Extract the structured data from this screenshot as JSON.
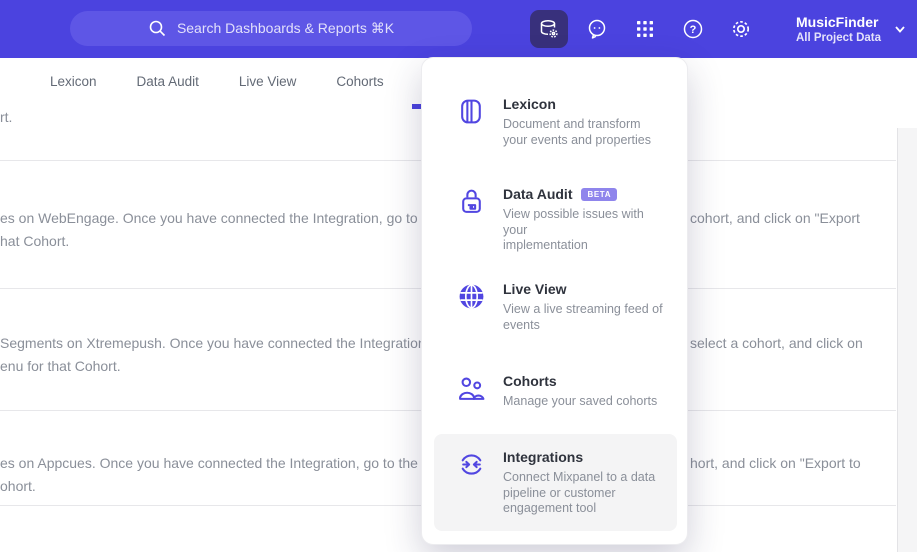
{
  "header": {
    "search": {
      "placeholder": "Search Dashboards & Reports ⌘K",
      "icon": "search-icon"
    },
    "nav_icons": [
      {
        "name": "data-management-icon",
        "active": true
      },
      {
        "name": "feedback-icon",
        "active": false
      },
      {
        "name": "apps-grid-icon",
        "active": false
      },
      {
        "name": "help-icon",
        "active": false
      },
      {
        "name": "settings-gear-icon",
        "active": false
      }
    ],
    "project": {
      "name": "MusicFinder",
      "subtitle": "All Project Data",
      "chevron": "chevron-down-icon"
    }
  },
  "tabs": {
    "items": [
      "Lexicon",
      "Data Audit",
      "Live View",
      "Cohorts"
    ],
    "accent_color": "#4b43df"
  },
  "menu": {
    "items": [
      {
        "title": "Lexicon",
        "icon": "book-icon",
        "desc_lines": [
          "Document and transform",
          "your events and properties"
        ]
      },
      {
        "title": "Data Audit",
        "badge": "BETA",
        "icon": "lock-audit-icon",
        "desc_lines": [
          "View possible issues with your",
          "implementation"
        ]
      },
      {
        "title": "Live View",
        "icon": "globe-icon",
        "desc_lines": [
          "View a live streaming feed of",
          "events"
        ]
      },
      {
        "title": "Cohorts",
        "icon": "cohorts-people-icon",
        "desc_lines": [
          "Manage your saved cohorts"
        ]
      },
      {
        "title": "Integrations",
        "icon": "sync-arrows-icon",
        "highlighted": true,
        "desc_lines": [
          "Connect Mixpanel to a data",
          "pipeline or customer",
          "engagement tool"
        ]
      }
    ]
  },
  "content_rows": [
    {
      "left_line1": "rt."
    },
    {
      "left_line1": "es on WebEngage. Once you have connected the Integration, go to the",
      "left_line2": "hat Cohort.",
      "right_line1": "cohort, and click on \"Export"
    },
    {
      "left_line1": "Segments on Xtremepush. Once you have connected the Integration, ",
      "left_line2": "enu for that Cohort.",
      "right_line1": "select a cohort, and click on"
    },
    {
      "left_line1": "es on Appcues. Once you have connected the Integration, go to the M",
      "left_line2": "ohort.",
      "right_line1": "hort, and click on \"Export to"
    }
  ],
  "colors": {
    "header_bg": "#4b43df",
    "search_pill_bg": "#5e56e6",
    "active_icon_bg": "#38307c",
    "menu_icon_accent": "#5146e1",
    "badge_bg": "#8f85ec",
    "highlight_bg": "#f4f4f5"
  }
}
